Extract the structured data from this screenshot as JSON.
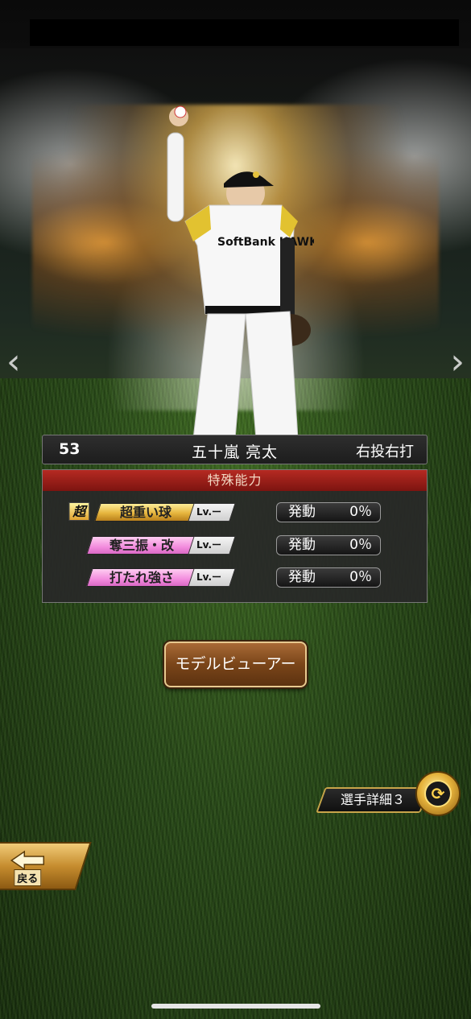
{
  "player": {
    "number": "53",
    "name": "五十嵐 亮太",
    "handedness": "右投右打",
    "jersey_text": "SoftBank HAWKS"
  },
  "abilities": {
    "header": "特殊能力",
    "items": [
      {
        "prefix": "超",
        "name": "超重い球",
        "level": "Lv.ー",
        "activation_label": "発動",
        "activation_value": "0％",
        "color": "#e6b53d"
      },
      {
        "prefix": "",
        "name": "奪三振・改",
        "level": "Lv.ー",
        "activation_label": "発動",
        "activation_value": "0％",
        "color": "#f28bdd"
      },
      {
        "prefix": "",
        "name": "打たれ強さ",
        "level": "Lv.ー",
        "activation_label": "発動",
        "activation_value": "0％",
        "color": "#f28bdd"
      }
    ]
  },
  "buttons": {
    "model_viewer": "モデルビューアー",
    "player_detail": "選手詳細３",
    "back": "戻る"
  },
  "nav": {
    "prev": "‹",
    "next": "›"
  }
}
